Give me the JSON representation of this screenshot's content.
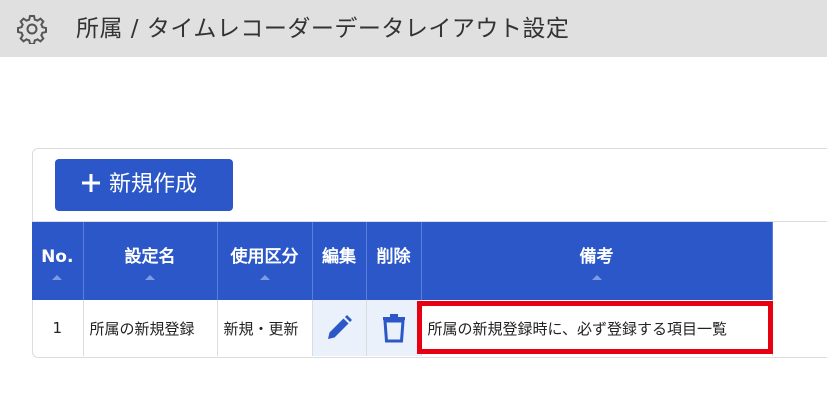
{
  "header": {
    "title": "所属 / タイムレコーダーデータレイアウト設定",
    "icon": "gear-icon"
  },
  "toolbar": {
    "new_label": "新規作成",
    "accent_color": "#2b57c9"
  },
  "table": {
    "columns": [
      {
        "label": "No."
      },
      {
        "label": "設定名"
      },
      {
        "label": "使用区分"
      },
      {
        "label": "編集"
      },
      {
        "label": "削除"
      },
      {
        "label": "備考"
      }
    ],
    "rows": [
      {
        "no": "1",
        "name": "所属の新規登録",
        "usage": "新規・更新",
        "edit_icon": "pencil-icon",
        "delete_icon": "trash-icon",
        "remarks": "所属の新規登録時に、必ず登録する項目一覧"
      }
    ]
  },
  "highlight_color": "#e60012"
}
